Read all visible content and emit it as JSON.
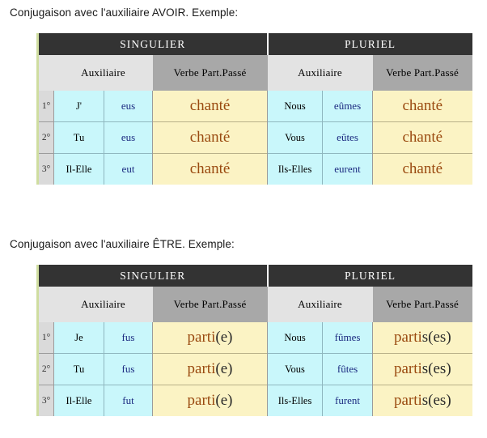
{
  "page": {
    "background": "#ffffff",
    "accent_border": "#cfdda0",
    "band_color": "#333333",
    "aux_header_color": "#e3e3e3",
    "verb_header_color": "#a8a8a8",
    "aux_cell_color": "#c9f7fb",
    "part_cell_color": "#fbf3c4",
    "participle_text_color": "#9a4a10",
    "conjugation_text_color": "#1b2a80"
  },
  "sections": [
    {
      "title": "Conjugaison avec l'auxiliaire AVOIR. Exemple:",
      "table": {
        "groups": [
          "SINGULIER",
          "PLURIEL"
        ],
        "subheaders": [
          "Auxiliaire",
          "Verbe Part.Passé",
          "Auxiliaire",
          "Verbe Part.Passé"
        ],
        "rows": [
          {
            "ordinal": "1°",
            "sing_pronoun": "J'",
            "sing_aux": "eus",
            "sing_participle": "chanté",
            "sing_participle_tail": "",
            "plur_pronoun": "Nous",
            "plur_aux": "eûmes",
            "plur_participle": "chanté",
            "plur_participle_tail": ""
          },
          {
            "ordinal": "2°",
            "sing_pronoun": "Tu",
            "sing_aux": "eus",
            "sing_participle": "chanté",
            "sing_participle_tail": "",
            "plur_pronoun": "Vous",
            "plur_aux": "eûtes",
            "plur_participle": "chanté",
            "plur_participle_tail": ""
          },
          {
            "ordinal": "3°",
            "sing_pronoun": "Il-Elle",
            "sing_aux": "eut",
            "sing_participle": "chanté",
            "sing_participle_tail": "",
            "plur_pronoun": "Ils-Elles",
            "plur_aux": "eurent",
            "plur_participle": "chanté",
            "plur_participle_tail": ""
          }
        ]
      }
    },
    {
      "title": "Conjugaison avec l'auxiliaire ÊTRE. Exemple:",
      "table": {
        "groups": [
          "SINGULIER",
          "PLURIEL"
        ],
        "subheaders": [
          "Auxiliaire",
          "Verbe Part.Passé",
          "Auxiliaire",
          "Verbe Part.Passé"
        ],
        "rows": [
          {
            "ordinal": "1°",
            "sing_pronoun": "Je",
            "sing_aux": "fus",
            "sing_participle": "parti",
            "sing_participle_tail": "(e)",
            "plur_pronoun": "Nous",
            "plur_aux": "fûmes",
            "plur_participle": "parti",
            "plur_participle_tail": "s(es)"
          },
          {
            "ordinal": "2°",
            "sing_pronoun": "Tu",
            "sing_aux": "fus",
            "sing_participle": "parti",
            "sing_participle_tail": "(e)",
            "plur_pronoun": "Vous",
            "plur_aux": "fûtes",
            "plur_participle": "parti",
            "plur_participle_tail": "s(es)"
          },
          {
            "ordinal": "3°",
            "sing_pronoun": "Il-Elle",
            "sing_aux": "fut",
            "sing_participle": "parti",
            "sing_participle_tail": "(e)",
            "plur_pronoun": "Ils-Elles",
            "plur_aux": "furent",
            "plur_participle": "parti",
            "plur_participle_tail": "s(es)"
          }
        ]
      }
    }
  ]
}
